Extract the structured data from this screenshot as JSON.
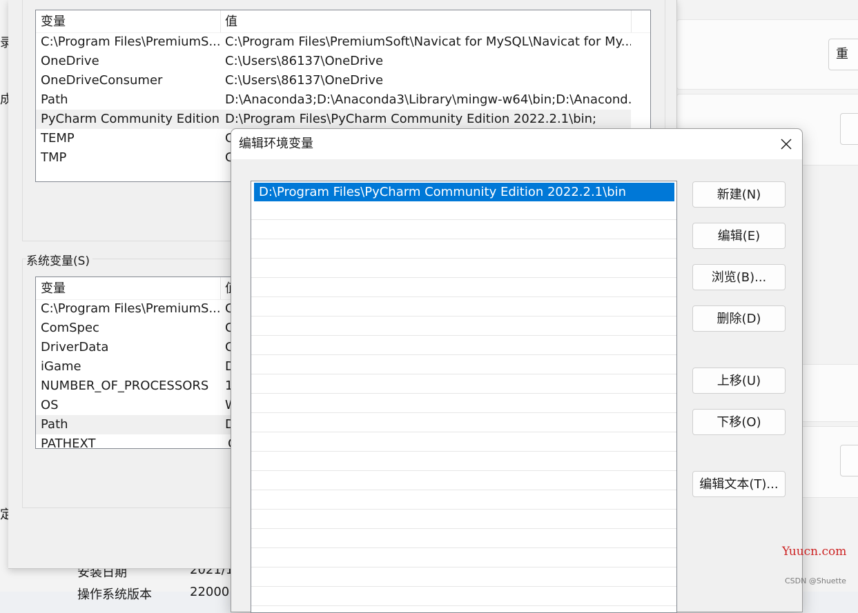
{
  "background": {
    "left_fragments": [
      "录.",
      "成",
      "定"
    ],
    "right_button_fragment": "重",
    "bottom_rows": [
      {
        "label": "安装日期",
        "value": "2021/1"
      },
      {
        "label": "操作系统版本",
        "value": "22000"
      }
    ]
  },
  "env_window": {
    "columns": {
      "variable": "变量",
      "value": "值"
    },
    "user_vars": [
      {
        "name": "C:\\Program Files\\PremiumS...",
        "value": "C:\\Program Files\\PremiumSoft\\Navicat for MySQL\\Navicat for My..."
      },
      {
        "name": "OneDrive",
        "value": "C:\\Users\\86137\\OneDrive"
      },
      {
        "name": "OneDriveConsumer",
        "value": "C:\\Users\\86137\\OneDrive"
      },
      {
        "name": "Path",
        "value": "D:\\Anaconda3;D:\\Anaconda3\\Library\\mingw-w64\\bin;D:\\Anacond..."
      },
      {
        "name": "PyCharm Community Edition",
        "value": "D:\\Program Files\\PyCharm Community Edition 2022.2.1\\bin;"
      },
      {
        "name": "TEMP",
        "value": "C"
      },
      {
        "name": "TMP",
        "value": "C"
      }
    ],
    "system_label": "系统变量(S)",
    "system_vars": [
      {
        "name": "C:\\Program Files\\PremiumS...",
        "value": "C"
      },
      {
        "name": "ComSpec",
        "value": "C"
      },
      {
        "name": "DriverData",
        "value": "C"
      },
      {
        "name": "iGame",
        "value": "D"
      },
      {
        "name": "NUMBER_OF_PROCESSORS",
        "value": "1"
      },
      {
        "name": "OS",
        "value": "W"
      },
      {
        "name": "Path",
        "value": "D"
      },
      {
        "name": "PATHEXT",
        "value": "C"
      }
    ],
    "system_value_header": "值"
  },
  "edit_dialog": {
    "title": "编辑环境变量",
    "entries": [
      "D:\\Program Files\\PyCharm Community Edition 2022.2.1\\bin"
    ],
    "buttons": {
      "new": "新建(N)",
      "edit": "编辑(E)",
      "browse": "浏览(B)...",
      "delete": "删除(D)",
      "move_up": "上移(U)",
      "move_down": "下移(O)",
      "edit_text": "编辑文本(T)..."
    }
  },
  "watermarks": {
    "site": "Yuucn.com",
    "credit": "CSDN @Shuette"
  },
  "colors": {
    "selection": "#0078d7",
    "watermark": "#cc2222"
  }
}
